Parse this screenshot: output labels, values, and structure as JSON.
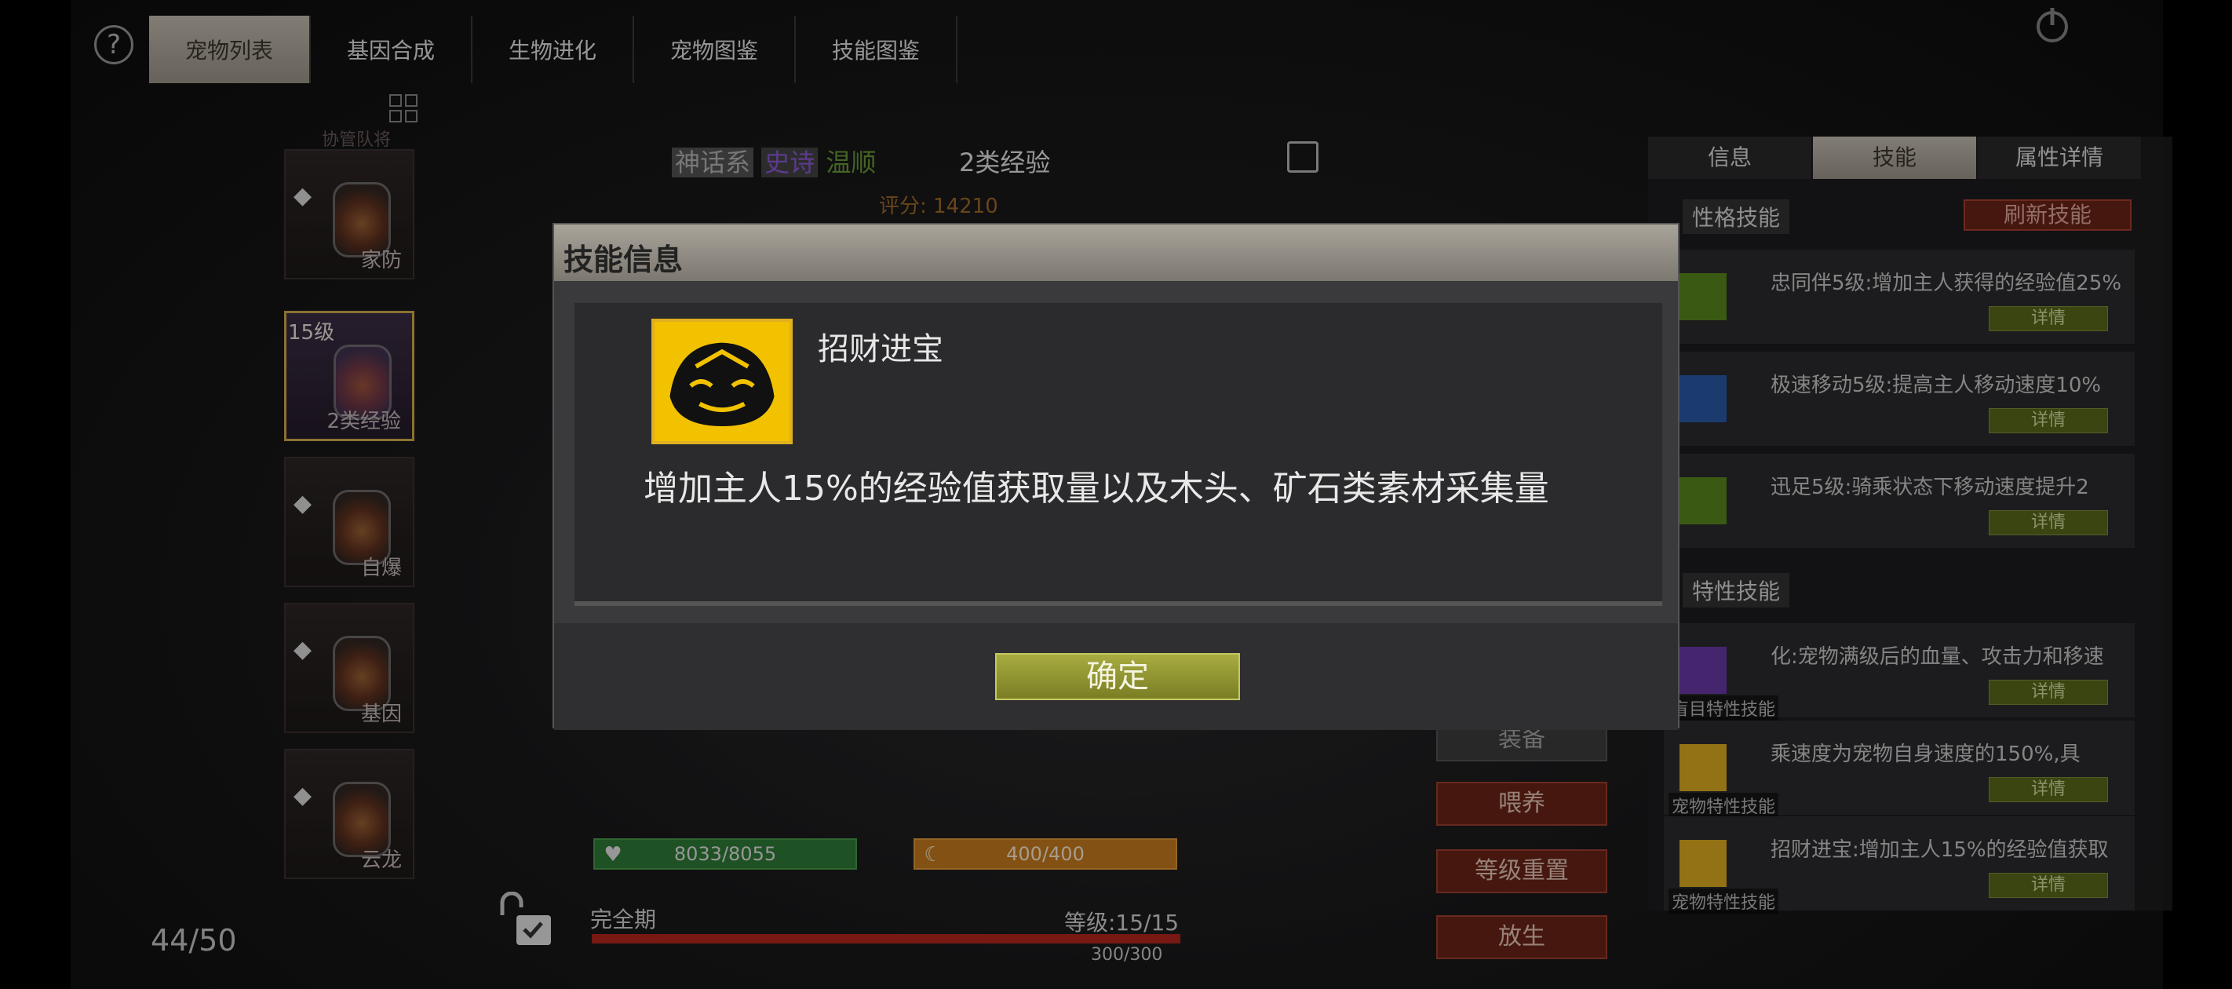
{
  "tabs": [
    {
      "label": "宠物列表",
      "active": true
    },
    {
      "label": "基因合成",
      "active": false
    },
    {
      "label": "生物进化",
      "active": false
    },
    {
      "label": "宠物图鉴",
      "active": false
    },
    {
      "label": "技能图鉴",
      "active": false
    }
  ],
  "help_icon": "?",
  "pet_list": {
    "top_cut_label": "协管队将",
    "items": [
      {
        "level": "",
        "status": "",
        "name": "家防"
      },
      {
        "level": "15级",
        "status": "",
        "name": "2类经验"
      },
      {
        "level": "",
        "status": "",
        "name": "自爆"
      },
      {
        "level": "",
        "status": "",
        "name": "基因"
      },
      {
        "level": "",
        "status": "",
        "name": "云龙"
      }
    ],
    "count": "44/50"
  },
  "pet_info": {
    "series": "神话系",
    "rarity": "史诗",
    "temper": "温顺",
    "exp_type": "2类经验",
    "score_label": "评分:",
    "score_value": "14210"
  },
  "bars": {
    "hp_text": "8033/8055",
    "mp_text": "400/400",
    "stage": "完全期",
    "level_text": "等级:15/15",
    "xp_text": "300/300"
  },
  "actions": [
    "装备",
    "喂养",
    "等级重置",
    "放生"
  ],
  "right_tabs": [
    {
      "label": "信息",
      "active": false
    },
    {
      "label": "技能",
      "active": true
    },
    {
      "label": "属性详情",
      "active": false
    }
  ],
  "skills": {
    "personality_title": "性格技能",
    "refresh_label": "刷新技能",
    "personality": [
      {
        "text": "忠同伴5级:增加主人获得的经验值25%",
        "btn": "详情",
        "color": "#5a8a1e"
      },
      {
        "text": "极速移动5级:提高主人移动速度10%",
        "btn": "详情",
        "color": "#2a5aa8"
      },
      {
        "text": "迅足5级:骑乘状态下移动速度提升2",
        "btn": "详情",
        "color": "#5a8a1e"
      }
    ],
    "trait_title": "特性技能",
    "trait": [
      {
        "text": "化:宠物满级后的血量、攻击力和移速",
        "btn": "详情",
        "label": "盲目特性技能",
        "color": "#6a3aa8"
      },
      {
        "text": "乘速度为宠物自身速度的150%,具",
        "btn": "详情",
        "label": "宠物特性技能",
        "color": "#e0b020"
      },
      {
        "text": "招财进宝:增加主人15%的经验值获取",
        "btn": "详情",
        "label": "宠物特性技能",
        "color": "#e0b020"
      }
    ]
  },
  "modal": {
    "title": "技能信息",
    "skill_name": "招财进宝",
    "skill_desc": "增加主人15%的经验值获取量以及木头、矿石类素材采集量",
    "ok_label": "确定"
  }
}
